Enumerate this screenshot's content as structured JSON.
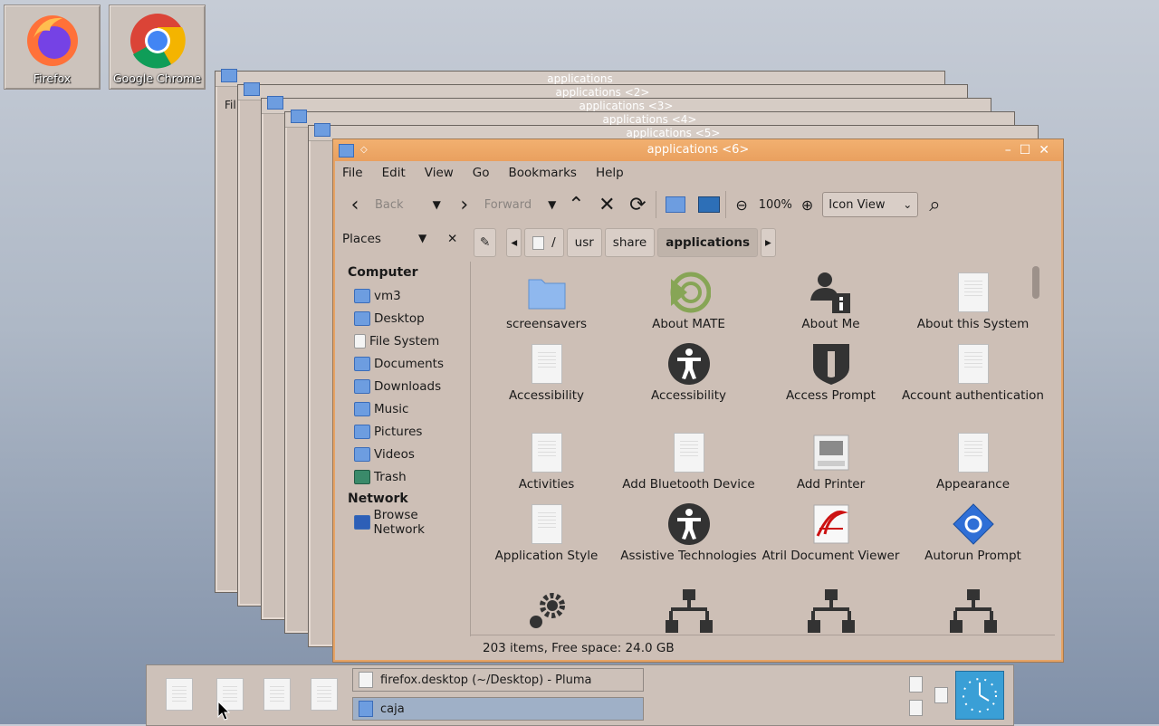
{
  "desktop": {
    "icons": [
      {
        "label": "Firefox"
      },
      {
        "label": "Google Chrome"
      }
    ]
  },
  "background_windows": [
    {
      "title": "applications"
    },
    {
      "title": "applications <2>"
    },
    {
      "title": "applications <3>"
    },
    {
      "title": "applications <4>"
    },
    {
      "title": "applications <5>"
    }
  ],
  "window": {
    "title": "applications <6>",
    "menu": [
      "File",
      "Edit",
      "View",
      "Go",
      "Bookmarks",
      "Help"
    ],
    "toolbar": {
      "back": "Back",
      "forward": "Forward",
      "zoom": "100%",
      "view_mode": "Icon View"
    },
    "sidebar_mode": "Places",
    "breadcrumbs": [
      "/",
      "usr",
      "share",
      "applications"
    ],
    "sidebar": {
      "computer_header": "Computer",
      "computer_items": [
        "vm3",
        "Desktop",
        "File System",
        "Documents",
        "Downloads",
        "Music",
        "Pictures",
        "Videos",
        "Trash"
      ],
      "network_header": "Network",
      "network_items": [
        "Browse Network"
      ]
    },
    "items": [
      {
        "label": "screensavers",
        "icon": "folder"
      },
      {
        "label": "About MATE",
        "icon": "mate-logo"
      },
      {
        "label": "About Me",
        "icon": "user-info"
      },
      {
        "label": "About this System",
        "icon": "document"
      },
      {
        "label": "Accessibility",
        "icon": "document"
      },
      {
        "label": "Accessibility",
        "icon": "accessibility"
      },
      {
        "label": "Access Prompt",
        "icon": "shield"
      },
      {
        "label": "Account authentication",
        "icon": "document"
      },
      {
        "label": "Activities",
        "icon": "document"
      },
      {
        "label": "Add Bluetooth Device",
        "icon": "document"
      },
      {
        "label": "Add Printer",
        "icon": "printer"
      },
      {
        "label": "Appearance",
        "icon": "document"
      },
      {
        "label": "Application Style",
        "icon": "document"
      },
      {
        "label": "Assistive Technologies",
        "icon": "accessibility"
      },
      {
        "label": "Atril Document Viewer",
        "icon": "atril"
      },
      {
        "label": "Autorun Prompt",
        "icon": "autorun"
      },
      {
        "label": "",
        "icon": "gear"
      },
      {
        "label": "",
        "icon": "network"
      },
      {
        "label": "",
        "icon": "network"
      },
      {
        "label": "",
        "icon": "network"
      }
    ],
    "status": "203 items, Free space: 24.0 GB"
  },
  "panel": {
    "tasks": [
      {
        "label": "firefox.desktop (~/Desktop) - Pluma",
        "active": false
      },
      {
        "label": "caja",
        "active": true
      }
    ]
  }
}
